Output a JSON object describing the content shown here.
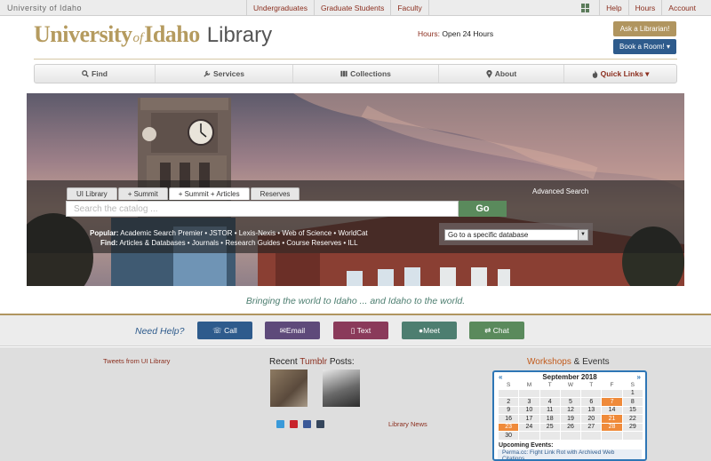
{
  "topbar": {
    "brand": "University of Idaho",
    "audience": [
      "Undergraduates",
      "Graduate Students",
      "Faculty"
    ],
    "links": [
      "Help",
      "Hours",
      "Account"
    ]
  },
  "header": {
    "logo_university": "University",
    "logo_of": "of",
    "logo_idaho": "Idaho",
    "logo_library": "Library",
    "hours_label": "Hours:",
    "hours_value": "Open 24 Hours",
    "ask_button": "Ask a Librarian!",
    "book_button": "Book a Room! ▾"
  },
  "nav": [
    {
      "label": "Find",
      "icon": "search-icon"
    },
    {
      "label": "Services",
      "icon": "wrench-icon"
    },
    {
      "label": "Collections",
      "icon": "columns-icon"
    },
    {
      "label": "About",
      "icon": "map-marker-icon"
    },
    {
      "label": "Quick Links ▾",
      "icon": "fire-icon"
    }
  ],
  "search": {
    "tabs": [
      "UI Library",
      "+ Summit",
      "+ Summit + Articles",
      "Reserves"
    ],
    "active_tab": 2,
    "advanced": "Advanced Search",
    "placeholder": "Search the catalog ...",
    "go": "Go",
    "popular_label": "Popular:",
    "popular_items": "Academic Search Premier • JSTOR • Lexis-Nexis • Web of Science • WorldCat",
    "find_label": "Find:",
    "find_items": "Articles & Databases • Journals • Research Guides • Course Reserves • ILL",
    "db_select": "Go to a specific database"
  },
  "tagline": "Bringing the world to Idaho ... and Idaho to the world.",
  "help": {
    "label": "Need Help?",
    "buttons": [
      {
        "label": "Call",
        "color": "#2e5b8c",
        "icon": "phone-icon"
      },
      {
        "label": "Email",
        "color": "#5e4a7a",
        "icon": "envelope-icon"
      },
      {
        "label": "Text",
        "color": "#8a3a5a",
        "icon": "mobile-icon"
      },
      {
        "label": "Meet",
        "color": "#4d7e70",
        "icon": "user-icon"
      },
      {
        "label": "Chat",
        "color": "#5a8a5c",
        "icon": "exchange-icon"
      }
    ]
  },
  "footer": {
    "tweets": "Tweets from UI Library",
    "recent_pre": "Recent ",
    "recent_brand": "Tumblr",
    "recent_post": " Posts:",
    "library_news": "Library News",
    "social_colors": [
      "#3a9ad9",
      "#c8232c",
      "#3b5998",
      "#35465c"
    ],
    "workshops": "Workshops",
    "events": " & Events"
  },
  "calendar": {
    "prev": "«",
    "next": "»",
    "month": "September 2018",
    "weekdays": [
      "S",
      "M",
      "T",
      "W",
      "T",
      "F",
      "S"
    ],
    "weeks": [
      [
        "",
        "",
        "",
        "",
        "",
        "",
        "1"
      ],
      [
        "2",
        "3",
        "4",
        "5",
        "6",
        "7",
        "8"
      ],
      [
        "9",
        "10",
        "11",
        "12",
        "13",
        "14",
        "15"
      ],
      [
        "16",
        "17",
        "18",
        "19",
        "20",
        "21",
        "22"
      ],
      [
        "23",
        "24",
        "25",
        "26",
        "27",
        "28",
        "29"
      ],
      [
        "30",
        "",
        "",
        "",
        "",
        "",
        ""
      ]
    ],
    "upcoming_label": "Upcoming Events:",
    "upcoming_item": "Perma.cc: Fight Link Rot with Archived Web Citations"
  }
}
